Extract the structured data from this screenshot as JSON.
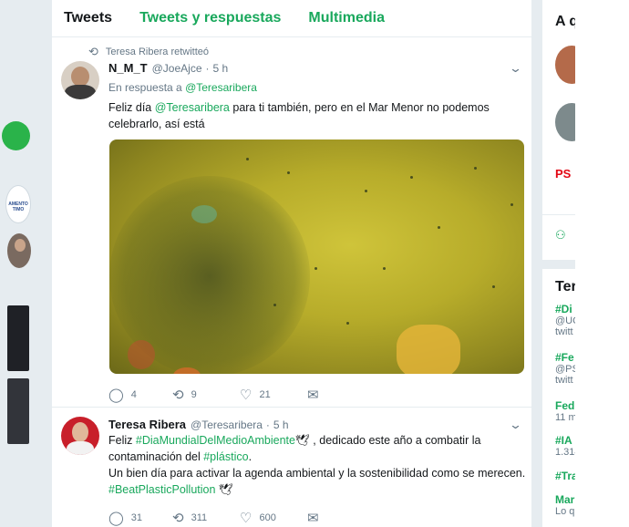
{
  "tabs": [
    {
      "label": "Tweets"
    },
    {
      "label": "Tweets y respuestas"
    },
    {
      "label": "Multimedia"
    }
  ],
  "left_strip": {
    "avatar_text": "AMENTO\nTIMO"
  },
  "tweet1": {
    "retweet_label": "Teresa Ribera retwitteó",
    "name": "N_M_T",
    "handle": "@JoeAjce",
    "dot": "·",
    "time": "5 h",
    "reply_prefix": "En respuesta a ",
    "reply_handle": "@Teresaribera",
    "text_prefix": "Feliz día ",
    "text_mention": "@Teresaribera",
    "text_line1_rest": " para ti también,  pero en el Mar Menor no podemos",
    "text_line2": "celebrarlo, así está",
    "replies": "4",
    "retweets": "9",
    "likes": "21"
  },
  "tweet2": {
    "name": "Teresa Ribera",
    "handle": "@Teresaribera",
    "dot": "·",
    "time": "5 h",
    "l1_a": "Feliz ",
    "l1_tag": "#DiaMundialDelMedioAmbiente",
    "l1_b": "🕊 , dedicado este año a combatir la",
    "l2_a": "contaminación del ",
    "l2_tag": "#plástico",
    "l2_b": ".",
    "l3": "Un bien día para activar la agenda ambiental y la sostenibilidad como se merecen.",
    "l4_tag": "#BeatPlasticPollution",
    "l4_b": " 🕊",
    "replies": "31",
    "retweets": "311",
    "likes": "600"
  },
  "icons": {
    "retweet": "retweet-icon",
    "reply": "reply-icon",
    "like": "heart-icon",
    "message": "envelope-icon",
    "chevron": "chevron-down-icon"
  },
  "right": {
    "title": "A q",
    "psoe": "PS",
    "trends_title": "Ter",
    "trends": [
      {
        "tag": "#Di",
        "sub": "@UG",
        "sub2": "twitt"
      },
      {
        "tag": "#Fe",
        "sub": "@PS",
        "sub2": "twitt"
      },
      {
        "tag": "Fed",
        "sub": "11 m",
        "sub2": ""
      },
      {
        "tag": "#IA",
        "sub": "1.314",
        "sub2": ""
      },
      {
        "tag": "#Tra",
        "sub": "",
        "sub2": ""
      },
      {
        "tag": "Mar",
        "sub": "Lo q",
        "sub2": ""
      }
    ]
  },
  "colors": {
    "accent": "#19a85c",
    "background": "#e6ecf0",
    "text": "#14171a",
    "muted": "#657786"
  }
}
